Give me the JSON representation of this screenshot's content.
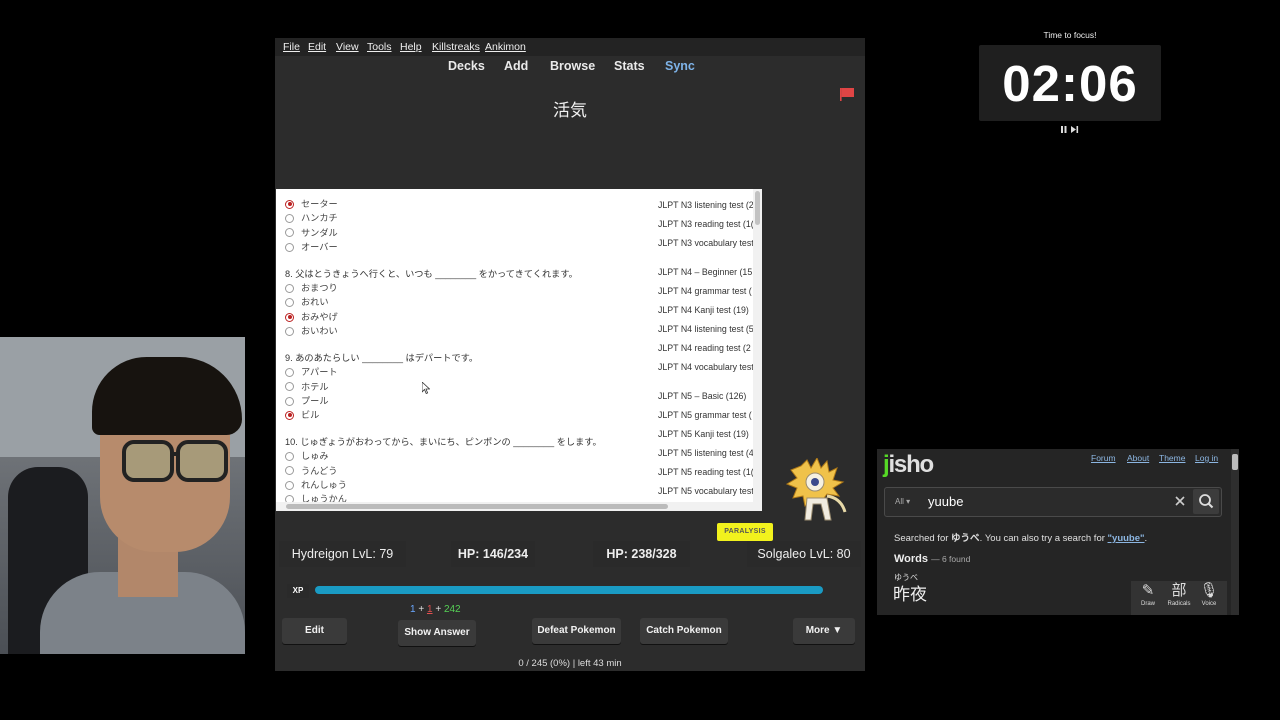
{
  "anki": {
    "menu": [
      "File",
      "Edit",
      "View",
      "Tools",
      "Help",
      "Killstreaks",
      "Ankimon"
    ],
    "toolbar": [
      "Decks",
      "Add",
      "Browse",
      "Stats",
      "Sync"
    ],
    "card_word": "活気",
    "quiz": {
      "q7_options": [
        "セーター",
        "ハンカチ",
        "サンダル",
        "オーバー"
      ],
      "q8_text": "8. 父はとうきょうへ行くと、いつも ________ をかってきてくれます。",
      "q8_options": [
        "おまつり",
        "おれい",
        "おみやげ",
        "おいわい"
      ],
      "q9_text": "9. あのあたらしい ________ はデパートです。",
      "q9_options": [
        "アパート",
        "ホテル",
        "プール",
        "ビル"
      ],
      "q10_text": "10. じゅぎょうがおわってから、まいにち、ピンポンの ________ をします。",
      "q10_options": [
        "しゅみ",
        "うんどう",
        "れんしゅう",
        "しゅうかん"
      ]
    },
    "test_links": [
      "JLPT N3 listening test (2",
      "JLPT N3 reading test (1(",
      "JLPT N3 vocabulary test",
      "JLPT N4 – Beginner (15",
      "JLPT N4 grammar test (",
      "JLPT N4 Kanji test (19)",
      "JLPT N4 listening test (5",
      "JLPT N4 reading test (2",
      "JLPT N4 vocabulary test",
      "JLPT N5 – Basic (126)",
      "JLPT N5 grammar test (",
      "JLPT N5 Kanji test (19)",
      "JLPT N5 listening test (4",
      "JLPT N5 reading test (1(",
      "JLPT N5 vocabulary test"
    ],
    "battle": {
      "status": "PARALYSIS",
      "player_name": "Hydreigon LvL: 79",
      "player_hp": "HP: 146/234",
      "enemy_hp": "HP: 238/328",
      "enemy_name": "Solgaleo LvL: 80",
      "xp_label": "XP",
      "xp_fraction": 1.0
    },
    "counts": {
      "new": "1",
      "learn": "1",
      "review": "242",
      "plus": "+"
    },
    "buttons": {
      "edit": "Edit",
      "show_answer": "Show Answer",
      "defeat": "Defeat Pokemon",
      "catch": "Catch Pokemon",
      "more": "More ▼"
    },
    "progress": "0 / 245 (0%) | left 43 min"
  },
  "timer": {
    "caption": "Time to focus!",
    "value": "02:06"
  },
  "jisho": {
    "nav": [
      "Forum",
      "About",
      "Theme",
      "Log in"
    ],
    "filter": "All ▾",
    "query": "yuube",
    "searched_prefix": "Searched for ",
    "searched_keyword": "ゆうべ",
    "searched_middle": ". You can also try a search for ",
    "searched_alt": "\"yuube\"",
    "searched_suffix": ".",
    "words_label": "Words",
    "words_count": "— 6 found",
    "result_furigana": "ゆうべ",
    "result_kanji": "昨夜",
    "tools": [
      "Draw",
      "Radicals",
      "Voice"
    ],
    "colors": {
      "accent": "#56d926",
      "link": "#8cb6e2"
    }
  }
}
